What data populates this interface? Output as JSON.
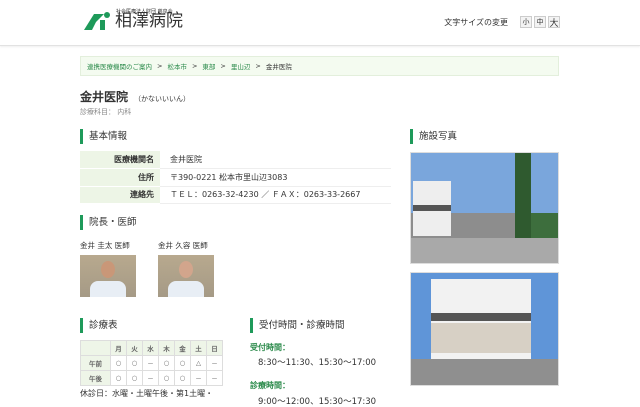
{
  "header": {
    "logo_sub": "社会医療法人財団 慈泉会",
    "logo_name": "相澤病院",
    "font_size_label": "文字サイズの変更",
    "font_sizes": [
      "小",
      "中",
      "大"
    ]
  },
  "breadcrumb": [
    "連携医療機関のご案内",
    "松本市",
    "東部",
    "里山辺",
    "金井医院"
  ],
  "breadcrumb_sep": ">",
  "title": "金井医院",
  "reading": "（かないいいん）",
  "dept": "診療科目： 内科",
  "basic": {
    "heading": "基本情報",
    "rows": [
      {
        "label": "医療機関名",
        "value": "金井医院"
      },
      {
        "label": "住所",
        "value": "〒390-0221 松本市里山辺3083"
      },
      {
        "label": "連絡先",
        "value": "ＴＥＬ：0263-32-4230 ／ ＦＡＸ：0263-33-2667"
      }
    ]
  },
  "doctors": {
    "heading": "院長・医師",
    "list": [
      "金井 圭太 医師",
      "金井 久容 医師"
    ]
  },
  "schedule": {
    "heading": "診療表",
    "days": [
      "月",
      "火",
      "水",
      "木",
      "金",
      "土",
      "日"
    ],
    "rows": [
      {
        "label": "午前",
        "marks": [
          "○",
          "○",
          "－",
          "○",
          "○",
          "△",
          "－"
        ]
      },
      {
        "label": "午後",
        "marks": [
          "○",
          "○",
          "－",
          "○",
          "○",
          "－",
          "－"
        ]
      }
    ],
    "closed": "休診日：水曜・土曜午後・第1土曜・"
  },
  "hours": {
    "heading": "受付時間・診療時間",
    "reception_label": "受付時間：",
    "reception": "8:30～11:30、15:30～17:00",
    "consult_label": "診療時間：",
    "consult": "9:00～12:00、15:30～17:30"
  },
  "facility": {
    "heading": "施設写真"
  },
  "colors": {
    "accent": "#1e9a5a"
  }
}
